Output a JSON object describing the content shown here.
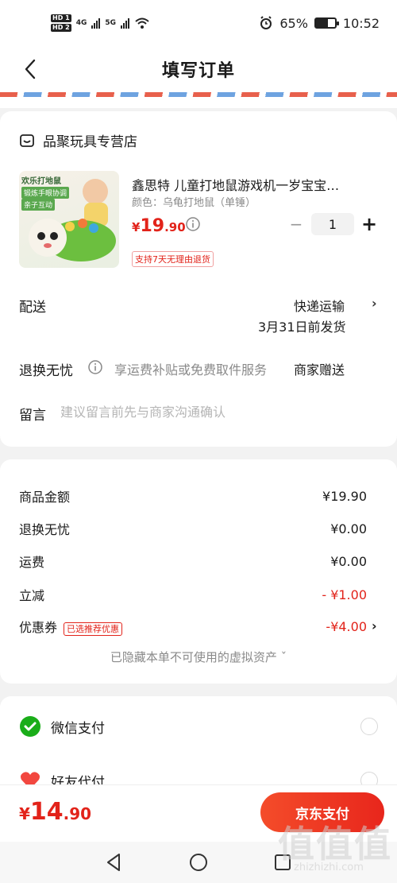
{
  "status_bar": {
    "hd1": "HD 1",
    "hd2": "HD 2",
    "net1": "4G",
    "net2": "5G",
    "battery_percent": "65%",
    "battery_level": 0.65,
    "time": "10:52"
  },
  "header": {
    "title": "填写订单"
  },
  "store": {
    "name": "品聚玩具专营店"
  },
  "product": {
    "image_tag1": "欢乐打地鼠",
    "image_tag2": "锻炼手眼协调",
    "image_tag3": "亲子互动",
    "title": "鑫思特 儿童打地鼠游戏机一岁宝宝…",
    "spec": "颜色：乌龟打地鼠（单锤）",
    "price_currency": "¥",
    "price_int": "19",
    "price_dec": ".90",
    "quantity": "1",
    "minus": "−",
    "plus": "+",
    "return_badge": "支持7天无理由退货"
  },
  "delivery": {
    "label": "配送",
    "method": "快递运输",
    "date": "3月31日前发货",
    "chevron": "›"
  },
  "return_service": {
    "label": "退换无忧",
    "desc": "享运费补贴或免费取件服务",
    "gift": "商家赠送"
  },
  "message": {
    "label": "留言",
    "placeholder": "建议留言前先与商家沟通确认"
  },
  "summary": {
    "rows": [
      {
        "label": "商品金额",
        "value": "¥19.90"
      },
      {
        "label": "退换无忧",
        "value": "¥0.00"
      },
      {
        "label": "运费",
        "value": "¥0.00"
      },
      {
        "label": "立减",
        "value": "- ¥1.00"
      },
      {
        "label": "优惠券",
        "badge": "已选推荐优惠",
        "value": "-¥4.00"
      }
    ],
    "coupon_chevron": "›",
    "hidden_assets": "已隐藏本单不可使用的虚拟资产 ˇ"
  },
  "payment": {
    "methods": [
      {
        "label": "微信支付",
        "icon": "wechat-pay-icon"
      },
      {
        "label": "好友代付",
        "icon": "friend-pay-icon"
      }
    ]
  },
  "bottom": {
    "total_currency": "¥",
    "total_int": "14",
    "total_dec": ".90",
    "pay_button": "京东支付"
  },
  "watermark": {
    "big": "值值值",
    "small": "zhizhizhi.com"
  },
  "colors": {
    "accent": "#e2231a",
    "wechat": "#1aad19"
  }
}
